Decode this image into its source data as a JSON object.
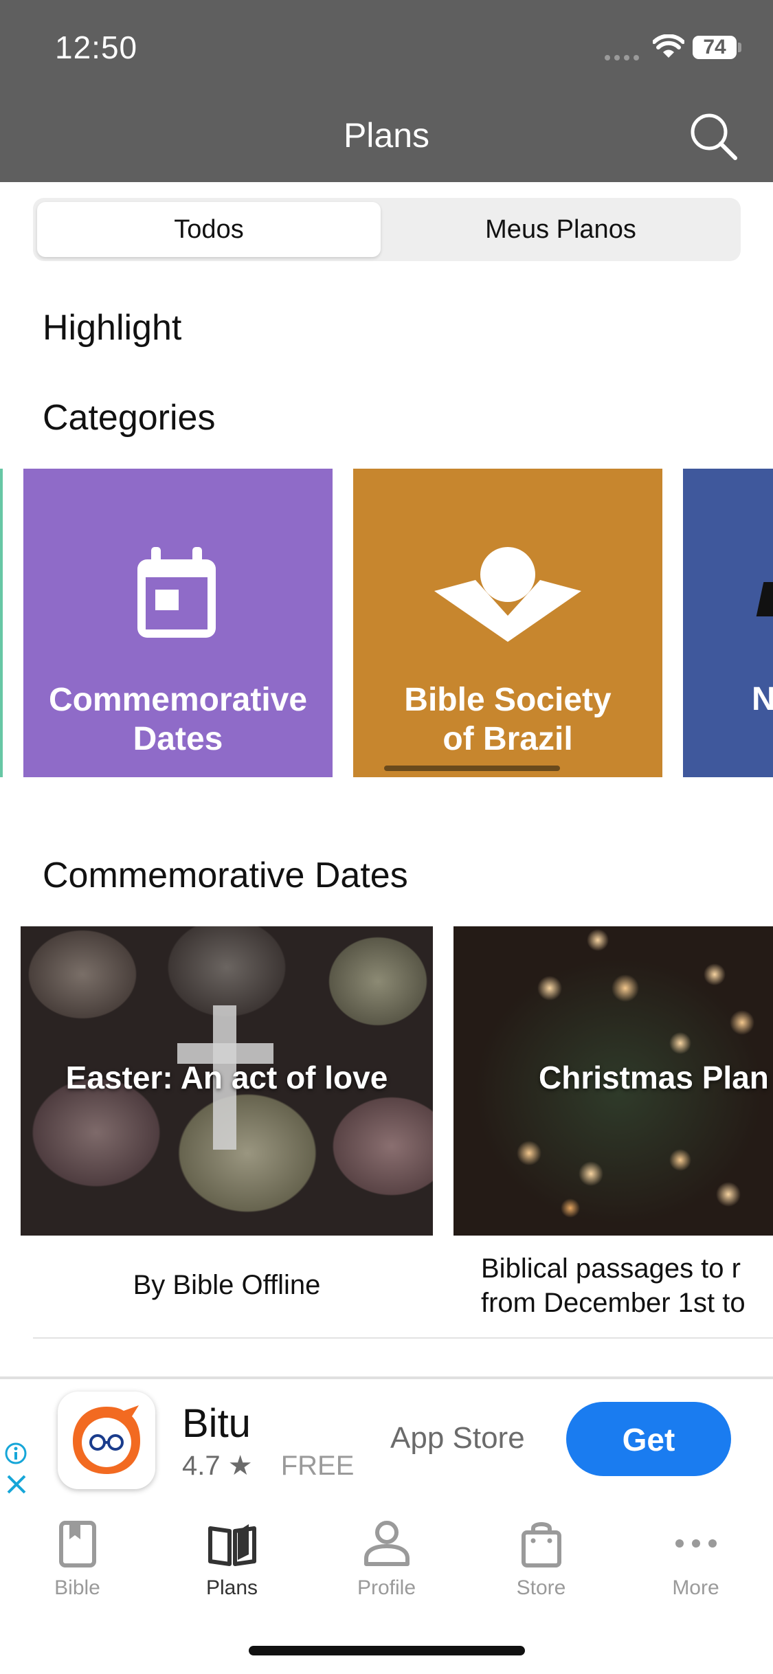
{
  "status": {
    "time": "12:50",
    "battery": "74"
  },
  "header": {
    "title": "Plans"
  },
  "segments": {
    "all": "Todos",
    "mine": "Meus Planos",
    "selected": "Todos"
  },
  "sections": {
    "highlight": "Highlight",
    "categories": "Categories",
    "commemorative": "Commemorative Dates"
  },
  "categories": [
    {
      "label_line1": "Commemorative",
      "label_line2": "Dates",
      "color": "#8f6bc8",
      "icon": "calendar-icon"
    },
    {
      "label_line1": "Bible Society",
      "label_line2": "of Brazil",
      "color": "#c7862e",
      "icon": "open-book-person-icon"
    },
    {
      "label": "N",
      "color": "#3f589c",
      "icon": "category-logo-icon"
    }
  ],
  "plans": [
    {
      "title": "Easter: An act of love",
      "subtitle": "By Bible Offline"
    },
    {
      "title": "Christmas Plan",
      "subtitle_line1": "Biblical passages to r",
      "subtitle_line2": "from December 1st to"
    }
  ],
  "ad": {
    "app_name": "Bitu",
    "rating": "4.7 ★",
    "price": "FREE",
    "store": "App Store",
    "cta": "Get"
  },
  "tabs": [
    {
      "label": "Bible",
      "icon": "book-icon"
    },
    {
      "label": "Plans",
      "icon": "open-book-icon",
      "active": true
    },
    {
      "label": "Profile",
      "icon": "person-icon"
    },
    {
      "label": "Store",
      "icon": "shopping-bag-icon"
    },
    {
      "label": "More",
      "icon": "more-dots-icon"
    }
  ],
  "colors": {
    "header": "#5f5f5f",
    "accent_blue": "#1a7cf0",
    "tab_inactive": "#9a9a9a",
    "ad_brand": "#f26a21"
  }
}
